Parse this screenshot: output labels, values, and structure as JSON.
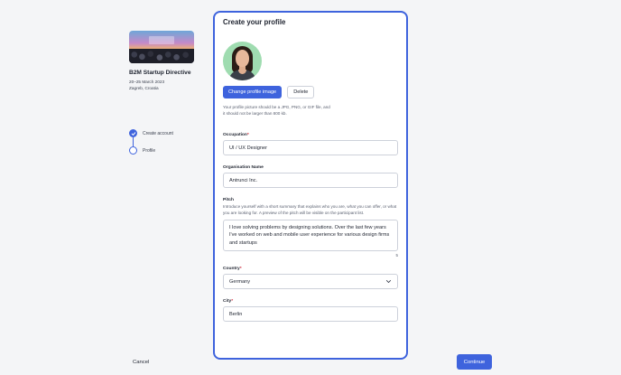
{
  "event": {
    "name": "B2M Startup Directive",
    "dates": "20–25 March 2023",
    "location": "Zagreb, Croatia"
  },
  "steps": [
    {
      "label": "Create account",
      "state": "done"
    },
    {
      "label": "Profile",
      "state": "current"
    }
  ],
  "profile": {
    "title": "Create your profile",
    "change_image_label": "Change profile image",
    "delete_label": "Delete",
    "image_hint": "Your profile picture should be a JPG, PNG, or GIF file, and it should not be larger than 800 kb."
  },
  "fields": {
    "occupation": {
      "label": "Occupation",
      "required_mark": "*",
      "value": "UI / UX Designer"
    },
    "organisation": {
      "label": "Organisation Name",
      "value": "Antrunci Inc."
    },
    "pitch": {
      "label": "Pitch",
      "help": "Introduce yourself with a short summary that explains who you are, what you can offer, or what you are looking for. A preview of the pitch will be visible on the participant list.",
      "value": "I love solving problems by designing solutions. Over the last few years I've worked on web and mobile user experience for various design firms and startups",
      "counter": "5"
    },
    "country": {
      "label": "Country",
      "required_mark": "*",
      "value": "Germany"
    },
    "city": {
      "label": "City",
      "required_mark": "*",
      "value": "Berlin"
    }
  },
  "footer": {
    "cancel_label": "Cancel",
    "continue_label": "Continue"
  },
  "colors": {
    "accent": "#3e63dd",
    "avatar_bg": "#9fdcb0",
    "required": "#d6283a"
  }
}
